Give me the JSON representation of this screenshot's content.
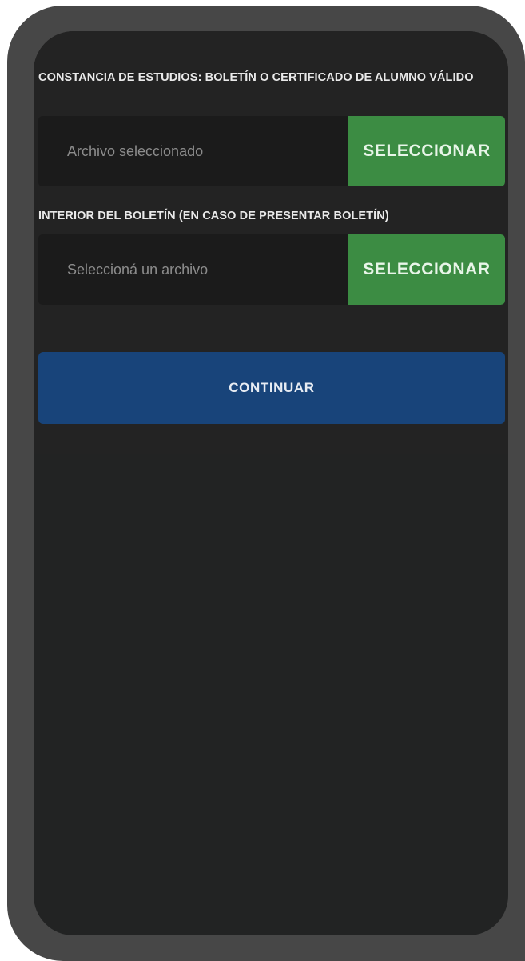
{
  "form": {
    "fields": [
      {
        "label": "CONSTANCIA DE ESTUDIOS: BOLETÍN O CERTIFICADO DE ALUMNO VÁLIDO",
        "file_text": "Archivo seleccionado",
        "button_label": "SELECCIONAR"
      },
      {
        "label": "INTERIOR DEL BOLETÍN (EN CASO DE PRESENTAR BOLETÍN)",
        "file_text": "Seleccioná un archivo",
        "button_label": "SELECCIONAR"
      }
    ],
    "continue_label": "CONTINUAR"
  },
  "colors": {
    "screen_background": "#222323",
    "frame": "#474747",
    "select_button": "#3c8c43",
    "continue_button": "#18447a",
    "input_background": "#1b1b1b"
  }
}
